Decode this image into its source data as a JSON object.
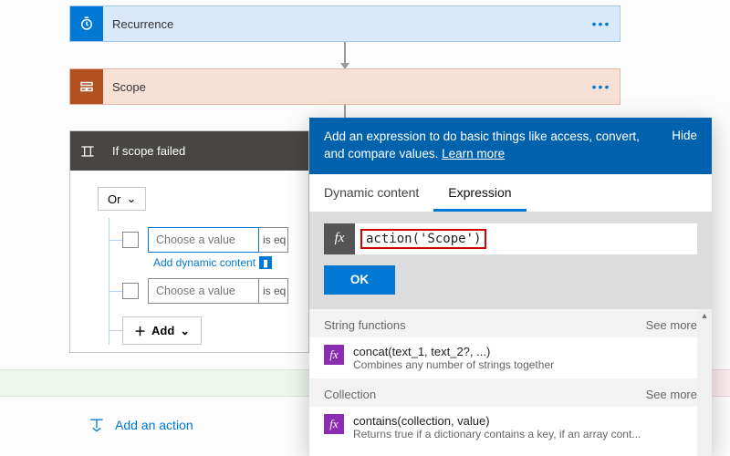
{
  "cards": {
    "recurrence": {
      "title": "Recurrence"
    },
    "scope": {
      "title": "Scope"
    }
  },
  "condition": {
    "title": "If scope failed",
    "logic_label": "Or",
    "row1_placeholder": "Choose a value",
    "row2_placeholder": "Choose a value",
    "op_label": "is eq",
    "dynamic_link": "Add dynamic content",
    "add_label": "Add"
  },
  "footer": {
    "add_action": "Add an action"
  },
  "panel": {
    "message": "Add an expression to do basic things like access, convert, and compare values. ",
    "learn_more": "Learn more",
    "hide": "Hide",
    "tabs": {
      "dynamic": "Dynamic content",
      "expression": "Expression"
    },
    "fx_label": "fx",
    "expression_value": "action('Scope')",
    "ok": "OK",
    "groups": [
      {
        "name": "String functions",
        "see_more": "See more",
        "items": [
          {
            "sig": "concat(text_1, text_2?, ...)",
            "desc": "Combines any number of strings together"
          }
        ]
      },
      {
        "name": "Collection",
        "see_more": "See more",
        "items": [
          {
            "sig": "contains(collection, value)",
            "desc": "Returns true if a dictionary contains a key, if an array cont..."
          }
        ]
      }
    ]
  }
}
